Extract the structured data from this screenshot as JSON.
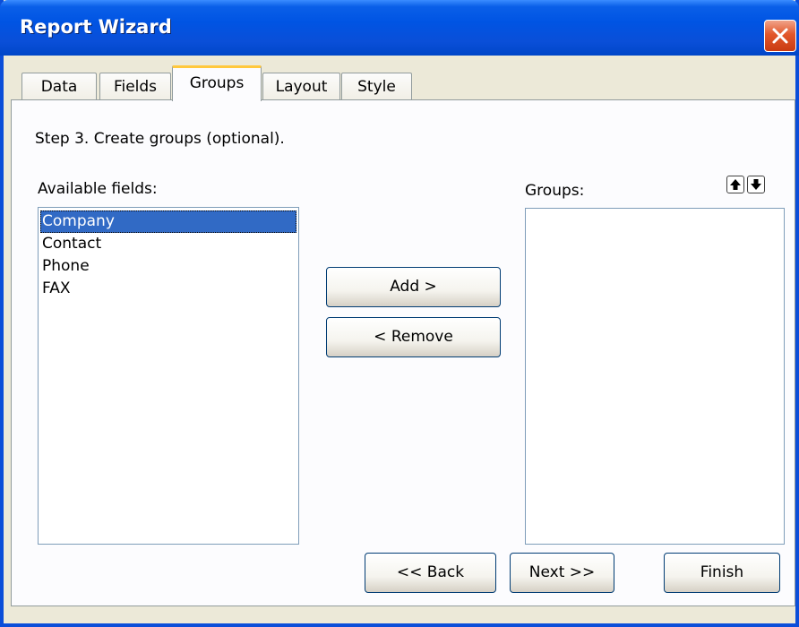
{
  "window": {
    "title": "Report Wizard"
  },
  "tabs": [
    {
      "label": "Data"
    },
    {
      "label": "Fields"
    },
    {
      "label": "Groups"
    },
    {
      "label": "Layout"
    },
    {
      "label": "Style"
    }
  ],
  "active_tab": "Groups",
  "step_text": "Step 3. Create groups (optional).",
  "available": {
    "label": "Available fields:",
    "items": [
      "Company",
      "Contact",
      "Phone",
      "FAX"
    ],
    "selected": "Company"
  },
  "groups": {
    "label": "Groups:",
    "items": []
  },
  "buttons": {
    "add": "Add >",
    "remove": "< Remove",
    "back": "<< Back",
    "next": "Next >>",
    "finish": "Finish"
  },
  "icons": {
    "move_up": "arrow-up-icon",
    "move_down": "arrow-down-icon",
    "close": "close-icon"
  },
  "colors": {
    "titlebar": "#0054e3",
    "selection": "#316ac5",
    "active_tab_accent": "#ffc83c",
    "close_button": "#e2572a"
  }
}
